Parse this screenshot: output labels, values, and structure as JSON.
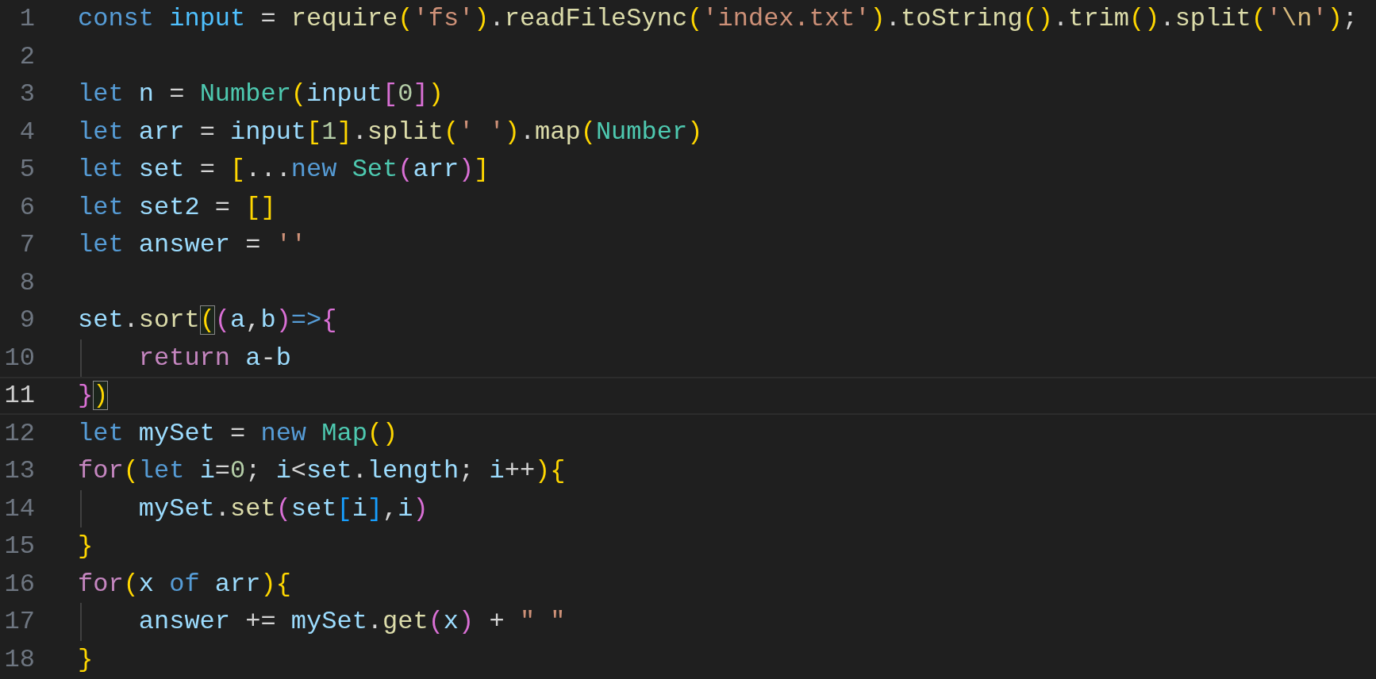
{
  "editor": {
    "lines": [
      {
        "number": "1",
        "active": false,
        "guide": false,
        "tokens": [
          {
            "text": "const",
            "kind": "keyword"
          },
          {
            "text": " input",
            "kind": "constant"
          },
          {
            "text": " = ",
            "kind": "plain"
          },
          {
            "text": "require",
            "kind": "function"
          },
          {
            "text": "(",
            "kind": "bracket1"
          },
          {
            "text": "'fs'",
            "kind": "string"
          },
          {
            "text": ")",
            "kind": "bracket1"
          },
          {
            "text": ".",
            "kind": "plain"
          },
          {
            "text": "readFileSync",
            "kind": "function"
          },
          {
            "text": "(",
            "kind": "bracket1"
          },
          {
            "text": "'index.txt'",
            "kind": "string"
          },
          {
            "text": ")",
            "kind": "bracket1"
          },
          {
            "text": ".",
            "kind": "plain"
          },
          {
            "text": "toString",
            "kind": "function"
          },
          {
            "text": "()",
            "kind": "bracket1"
          },
          {
            "text": ".",
            "kind": "plain"
          },
          {
            "text": "trim",
            "kind": "function"
          },
          {
            "text": "()",
            "kind": "bracket1"
          },
          {
            "text": ".",
            "kind": "plain"
          },
          {
            "text": "split",
            "kind": "function"
          },
          {
            "text": "(",
            "kind": "bracket1"
          },
          {
            "text": "'",
            "kind": "string"
          },
          {
            "text": "\\n",
            "kind": "escape"
          },
          {
            "text": "'",
            "kind": "string"
          },
          {
            "text": ")",
            "kind": "bracket1"
          },
          {
            "text": ";",
            "kind": "plain"
          }
        ]
      },
      {
        "number": "2",
        "active": false
      },
      {
        "number": "3",
        "active": false,
        "guide": false,
        "tokens": [
          {
            "text": "let",
            "kind": "keyword"
          },
          {
            "text": " n",
            "kind": "variable"
          },
          {
            "text": " = ",
            "kind": "plain"
          },
          {
            "text": "Number",
            "kind": "type"
          },
          {
            "text": "(",
            "kind": "bracket1"
          },
          {
            "text": "input",
            "kind": "variable"
          },
          {
            "text": "[",
            "kind": "bracket2"
          },
          {
            "text": "0",
            "kind": "number"
          },
          {
            "text": "]",
            "kind": "bracket2"
          },
          {
            "text": ")",
            "kind": "bracket1"
          }
        ]
      },
      {
        "number": "4",
        "active": false,
        "guide": false,
        "tokens": [
          {
            "text": "let",
            "kind": "keyword"
          },
          {
            "text": " arr",
            "kind": "variable"
          },
          {
            "text": " = ",
            "kind": "plain"
          },
          {
            "text": "input",
            "kind": "variable"
          },
          {
            "text": "[",
            "kind": "bracket1"
          },
          {
            "text": "1",
            "kind": "number"
          },
          {
            "text": "]",
            "kind": "bracket1"
          },
          {
            "text": ".",
            "kind": "plain"
          },
          {
            "text": "split",
            "kind": "function"
          },
          {
            "text": "(",
            "kind": "bracket1"
          },
          {
            "text": "' '",
            "kind": "string"
          },
          {
            "text": ")",
            "kind": "bracket1"
          },
          {
            "text": ".",
            "kind": "plain"
          },
          {
            "text": "map",
            "kind": "function"
          },
          {
            "text": "(",
            "kind": "bracket1"
          },
          {
            "text": "Number",
            "kind": "type"
          },
          {
            "text": ")",
            "kind": "bracket1"
          }
        ]
      },
      {
        "number": "5",
        "active": false,
        "guide": false,
        "tokens": [
          {
            "text": "let",
            "kind": "keyword"
          },
          {
            "text": " set",
            "kind": "variable"
          },
          {
            "text": " = ",
            "kind": "plain"
          },
          {
            "text": "[",
            "kind": "bracket1"
          },
          {
            "text": "...",
            "kind": "plain"
          },
          {
            "text": "new",
            "kind": "keyword"
          },
          {
            "text": " Set",
            "kind": "type"
          },
          {
            "text": "(",
            "kind": "bracket2"
          },
          {
            "text": "arr",
            "kind": "variable"
          },
          {
            "text": ")",
            "kind": "bracket2"
          },
          {
            "text": "]",
            "kind": "bracket1"
          }
        ]
      },
      {
        "number": "6",
        "active": false,
        "guide": false,
        "tokens": [
          {
            "text": "let",
            "kind": "keyword"
          },
          {
            "text": " set2",
            "kind": "variable"
          },
          {
            "text": " = ",
            "kind": "plain"
          },
          {
            "text": "[]",
            "kind": "bracket1"
          }
        ]
      },
      {
        "number": "7",
        "active": false,
        "guide": false,
        "tokens": [
          {
            "text": "let",
            "kind": "keyword"
          },
          {
            "text": " answer",
            "kind": "variable"
          },
          {
            "text": " = ",
            "kind": "plain"
          },
          {
            "text": "''",
            "kind": "string"
          }
        ]
      },
      {
        "number": "8",
        "active": false
      },
      {
        "number": "9",
        "active": false,
        "guide": false,
        "tokens": [
          {
            "text": "set",
            "kind": "variable"
          },
          {
            "text": ".",
            "kind": "plain"
          },
          {
            "text": "sort",
            "kind": "function"
          },
          {
            "text": "(",
            "kind": "bracket1",
            "matched": true
          },
          {
            "text": "(",
            "kind": "bracket2"
          },
          {
            "text": "a",
            "kind": "variable"
          },
          {
            "text": ",",
            "kind": "plain"
          },
          {
            "text": "b",
            "kind": "variable"
          },
          {
            "text": ")",
            "kind": "bracket2"
          },
          {
            "text": "=>",
            "kind": "keyword"
          },
          {
            "text": "{",
            "kind": "bracket2"
          }
        ]
      },
      {
        "number": "10",
        "active": false,
        "guide": true,
        "tokens": [
          {
            "text": "return",
            "kind": "control"
          },
          {
            "text": " a",
            "kind": "variable"
          },
          {
            "text": "-",
            "kind": "plain"
          },
          {
            "text": "b",
            "kind": "variable"
          }
        ]
      },
      {
        "number": "11",
        "active": true,
        "guide": false,
        "tokens": [
          {
            "text": "}",
            "kind": "bracket2"
          },
          {
            "text": ")",
            "kind": "bracket1",
            "matched": true
          }
        ]
      },
      {
        "number": "12",
        "active": false,
        "guide": false,
        "tokens": [
          {
            "text": "let",
            "kind": "keyword"
          },
          {
            "text": " mySet",
            "kind": "variable"
          },
          {
            "text": " = ",
            "kind": "plain"
          },
          {
            "text": "new",
            "kind": "keyword"
          },
          {
            "text": " Map",
            "kind": "type"
          },
          {
            "text": "()",
            "kind": "bracket1"
          }
        ]
      },
      {
        "number": "13",
        "active": false,
        "guide": false,
        "tokens": [
          {
            "text": "for",
            "kind": "control"
          },
          {
            "text": "(",
            "kind": "bracket1"
          },
          {
            "text": "let",
            "kind": "keyword"
          },
          {
            "text": " i",
            "kind": "variable"
          },
          {
            "text": "=",
            "kind": "plain"
          },
          {
            "text": "0",
            "kind": "number"
          },
          {
            "text": "; ",
            "kind": "plain"
          },
          {
            "text": "i",
            "kind": "variable"
          },
          {
            "text": "<",
            "kind": "plain"
          },
          {
            "text": "set",
            "kind": "variable"
          },
          {
            "text": ".",
            "kind": "plain"
          },
          {
            "text": "length",
            "kind": "variable"
          },
          {
            "text": "; ",
            "kind": "plain"
          },
          {
            "text": "i",
            "kind": "variable"
          },
          {
            "text": "++",
            "kind": "plain"
          },
          {
            "text": ")",
            "kind": "bracket1"
          },
          {
            "text": "{",
            "kind": "bracket1"
          }
        ]
      },
      {
        "number": "14",
        "active": false,
        "guide": true,
        "tokens": [
          {
            "text": "mySet",
            "kind": "variable"
          },
          {
            "text": ".",
            "kind": "plain"
          },
          {
            "text": "set",
            "kind": "function"
          },
          {
            "text": "(",
            "kind": "bracket2"
          },
          {
            "text": "set",
            "kind": "variable"
          },
          {
            "text": "[",
            "kind": "bracket3"
          },
          {
            "text": "i",
            "kind": "variable"
          },
          {
            "text": "]",
            "kind": "bracket3"
          },
          {
            "text": ",",
            "kind": "plain"
          },
          {
            "text": "i",
            "kind": "variable"
          },
          {
            "text": ")",
            "kind": "bracket2"
          }
        ]
      },
      {
        "number": "15",
        "active": false,
        "guide": false,
        "tokens": [
          {
            "text": "}",
            "kind": "bracket1"
          }
        ]
      },
      {
        "number": "16",
        "active": false,
        "guide": false,
        "tokens": [
          {
            "text": "for",
            "kind": "control"
          },
          {
            "text": "(",
            "kind": "bracket1"
          },
          {
            "text": "x",
            "kind": "variable"
          },
          {
            "text": " of",
            "kind": "keyword"
          },
          {
            "text": " arr",
            "kind": "variable"
          },
          {
            "text": ")",
            "kind": "bracket1"
          },
          {
            "text": "{",
            "kind": "bracket1"
          }
        ]
      },
      {
        "number": "17",
        "active": false,
        "guide": true,
        "tokens": [
          {
            "text": "answer",
            "kind": "variable"
          },
          {
            "text": " += ",
            "kind": "plain"
          },
          {
            "text": "mySet",
            "kind": "variable"
          },
          {
            "text": ".",
            "kind": "plain"
          },
          {
            "text": "get",
            "kind": "function"
          },
          {
            "text": "(",
            "kind": "bracket2"
          },
          {
            "text": "x",
            "kind": "variable"
          },
          {
            "text": ")",
            "kind": "bracket2"
          },
          {
            "text": " + ",
            "kind": "plain"
          },
          {
            "text": "\" \"",
            "kind": "string"
          }
        ]
      },
      {
        "number": "18",
        "active": false,
        "guide": false,
        "tokens": [
          {
            "text": "}",
            "kind": "bracket1"
          }
        ]
      }
    ]
  }
}
